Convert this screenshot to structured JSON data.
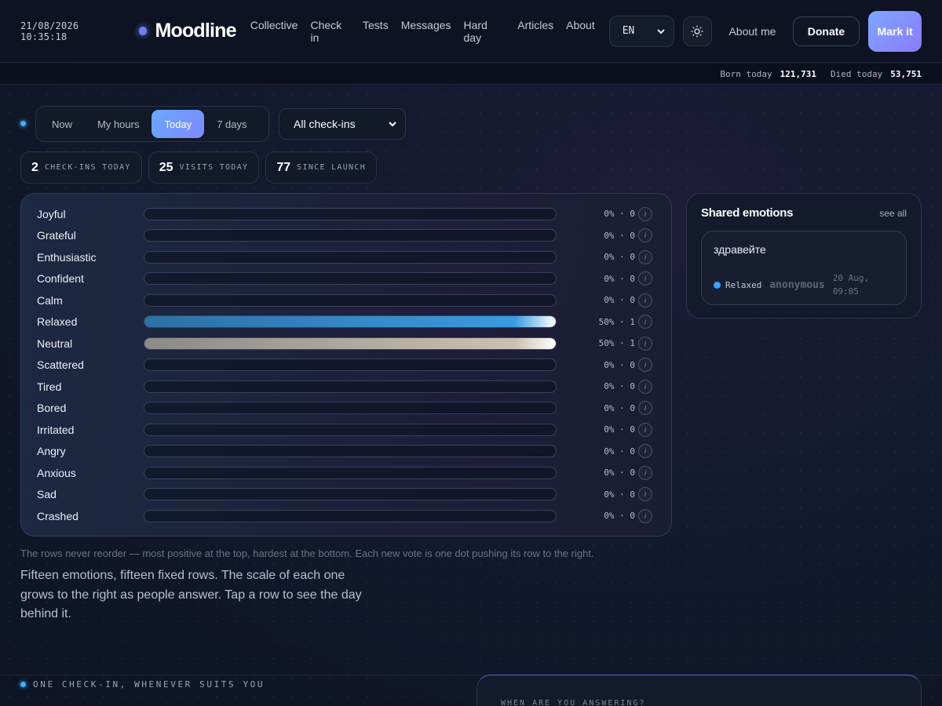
{
  "header": {
    "clock": "21/08/2026 10:35:18",
    "brand": "Moodline",
    "nav": [
      "Collective",
      "Check in",
      "Tests",
      "Messages",
      "Hard day",
      "Articles",
      "About"
    ],
    "language": "EN",
    "about_me": "About me",
    "donate": "Donate",
    "mark_it": "Mark it"
  },
  "world_stats": {
    "born_label": "Born today",
    "born_value": "121,731",
    "died_label": "Died today",
    "died_value": "53,751"
  },
  "controls": {
    "ranges": [
      "Now",
      "My hours",
      "Today",
      "7 days"
    ],
    "active_range": "Today",
    "filter": "All check-ins"
  },
  "counters": [
    {
      "value": "2",
      "label": "CHECK-INS TODAY"
    },
    {
      "value": "25",
      "label": "VISITS TODAY"
    },
    {
      "value": "77",
      "label": "SINCE LAUNCH"
    }
  ],
  "emotions": [
    {
      "name": "Joyful",
      "percent": 0,
      "count": 0,
      "color": ""
    },
    {
      "name": "Grateful",
      "percent": 0,
      "count": 0,
      "color": ""
    },
    {
      "name": "Enthusiastic",
      "percent": 0,
      "count": 0,
      "color": ""
    },
    {
      "name": "Confident",
      "percent": 0,
      "count": 0,
      "color": ""
    },
    {
      "name": "Calm",
      "percent": 0,
      "count": 0,
      "color": ""
    },
    {
      "name": "Relaxed",
      "percent": 50,
      "count": 1,
      "color": "#3a9be0"
    },
    {
      "name": "Neutral",
      "percent": 50,
      "count": 1,
      "color": "#c9c2b3"
    },
    {
      "name": "Scattered",
      "percent": 0,
      "count": 0,
      "color": ""
    },
    {
      "name": "Tired",
      "percent": 0,
      "count": 0,
      "color": ""
    },
    {
      "name": "Bored",
      "percent": 0,
      "count": 0,
      "color": ""
    },
    {
      "name": "Irritated",
      "percent": 0,
      "count": 0,
      "color": ""
    },
    {
      "name": "Angry",
      "percent": 0,
      "count": 0,
      "color": ""
    },
    {
      "name": "Anxious",
      "percent": 0,
      "count": 0,
      "color": ""
    },
    {
      "name": "Sad",
      "percent": 0,
      "count": 0,
      "color": ""
    },
    {
      "name": "Crashed",
      "percent": 0,
      "count": 0,
      "color": ""
    }
  ],
  "info_glyph": "i",
  "note": "The rows never reorder — most positive at the top, hardest at the bottom. Each new vote is one dot pushing its row to the right.",
  "intro": "Fifteen emotions, fifteen fixed rows. The scale of each one grows to the right as people answer. Tap a row to see the day behind it.",
  "shared": {
    "title": "Shared emotions",
    "see_all": "see all",
    "items": [
      {
        "text": "здравейте",
        "mood": "Relaxed",
        "author": "anonymous",
        "when": "20 Aug, 09:05"
      }
    ]
  },
  "bottom": {
    "section_label": "ONE CHECK-IN, WHENEVER SUITS YOU",
    "question_label": "WHEN ARE YOU ANSWERING?"
  },
  "colors": {
    "accent": "#7f88ff",
    "dot": "#3fb0ff"
  }
}
